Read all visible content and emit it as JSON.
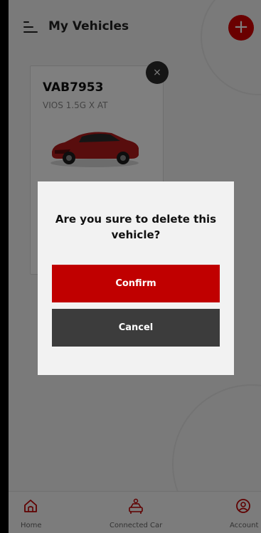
{
  "header": {
    "title": "My Vehicles",
    "menu_icon": "menu-icon",
    "add_icon": "plus-icon",
    "add_symbol": "+"
  },
  "vehicle": {
    "plate": "VAB7953",
    "model": "VIOS 1.5G X AT",
    "remove_symbol": "×",
    "car_color": "#b01a1a"
  },
  "dialog": {
    "message": "Are you sure to delete this vehicle?",
    "confirm_label": "Confirm",
    "cancel_label": "Cancel"
  },
  "bottom_nav": {
    "items": [
      {
        "label": "Home",
        "icon": "home-icon"
      },
      {
        "label": "Connected Car",
        "icon": "connected-car-icon"
      },
      {
        "label": "Account",
        "icon": "account-icon"
      }
    ]
  },
  "colors": {
    "accent": "#d40000",
    "confirm": "#c00000",
    "cancel": "#3c3c3c",
    "overlay": "rgba(0,0,0,0.5)"
  }
}
